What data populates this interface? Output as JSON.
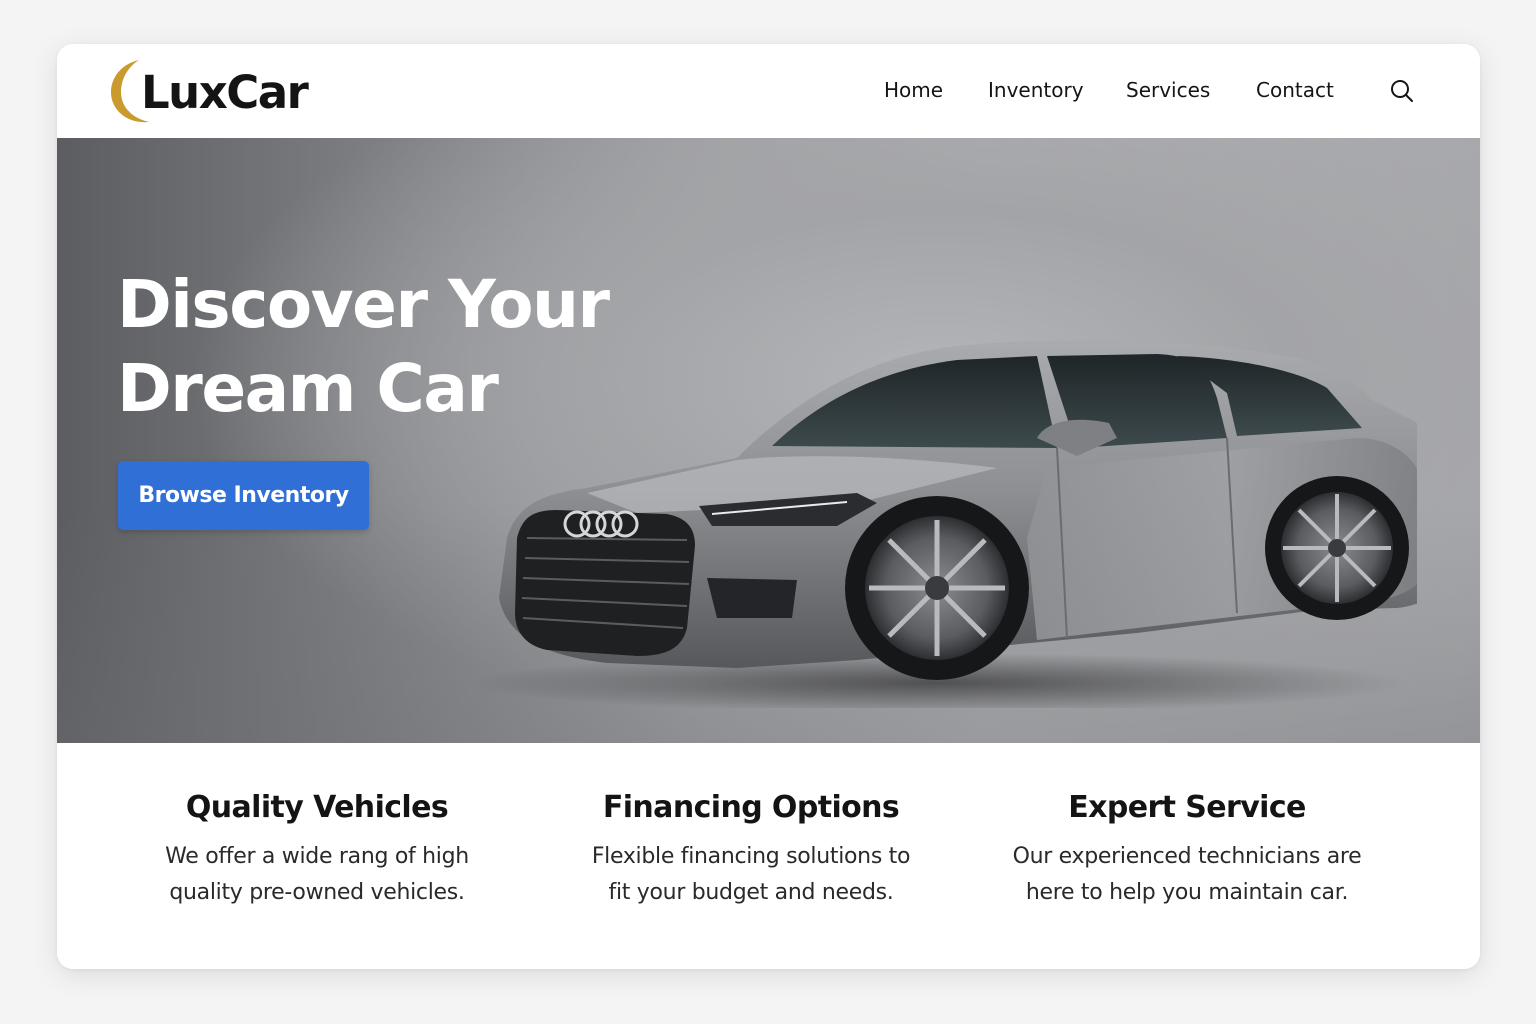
{
  "brand": {
    "name": "LuxCar",
    "accent_color": "#c99a2e"
  },
  "nav": {
    "items": [
      {
        "label": "Home"
      },
      {
        "label": "Inventory"
      },
      {
        "label": "Services"
      },
      {
        "label": "Contact"
      }
    ],
    "search_icon": "search-icon"
  },
  "hero": {
    "title_line1": "Discover Your",
    "title_line2": "Dream Car",
    "cta_label": "Browse Inventory",
    "cta_color": "#2f6fd6",
    "image": "silver-sedan"
  },
  "features": [
    {
      "title": "Quality Vehicles",
      "desc_line1": "We offer a wide rang of high",
      "desc_line2": "quality pre-owned vehicles."
    },
    {
      "title": "Financing Options",
      "desc_line1": "Flexible financing solutions to",
      "desc_line2": "fit your budget and needs."
    },
    {
      "title": "Expert Service",
      "desc_line1": "Our experienced technicians are",
      "desc_line2": "here to help you maintain car."
    }
  ]
}
